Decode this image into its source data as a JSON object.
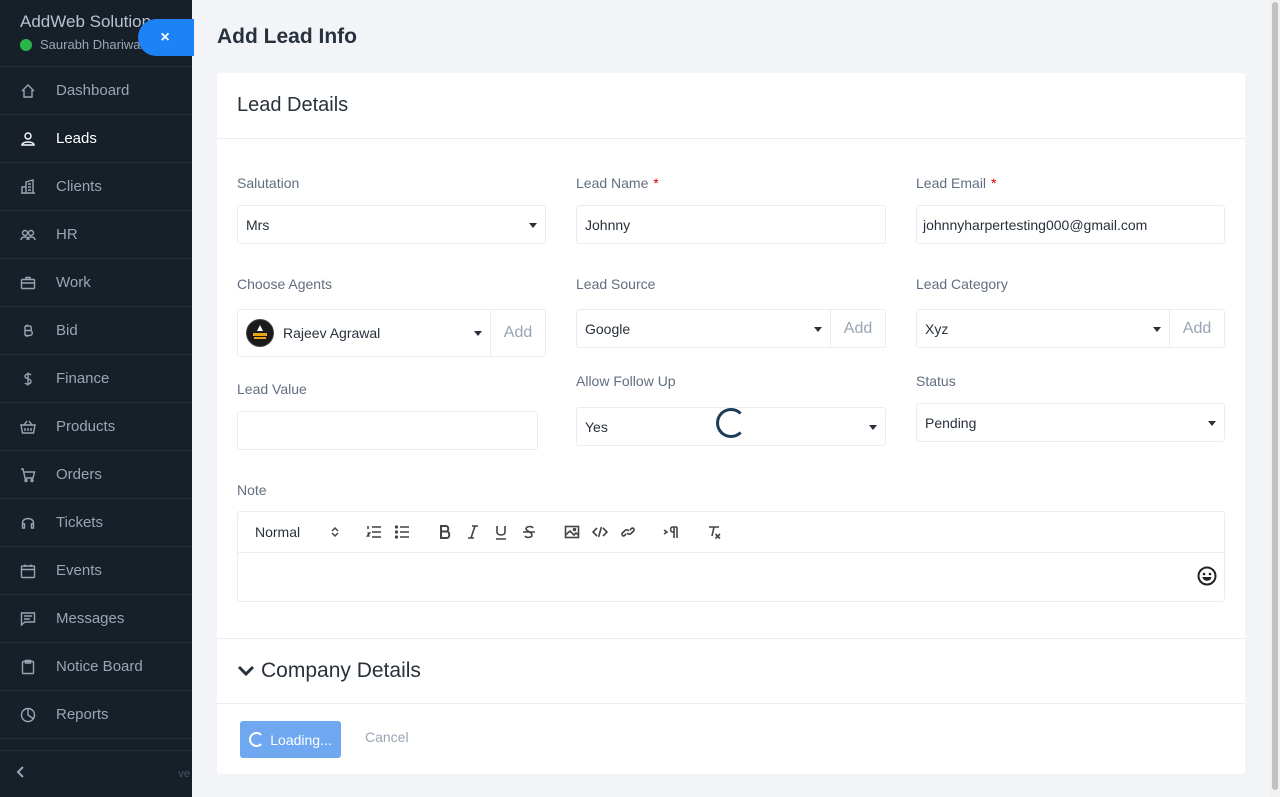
{
  "sidebar": {
    "company": "AddWeb Solution",
    "user": "Saurabh Dhariwal",
    "items": [
      {
        "label": "Dashboard",
        "icon": "home-icon"
      },
      {
        "label": "Leads",
        "icon": "user-icon"
      },
      {
        "label": "Clients",
        "icon": "building-icon"
      },
      {
        "label": "HR",
        "icon": "people-icon"
      },
      {
        "label": "Work",
        "icon": "briefcase-icon"
      },
      {
        "label": "Bid",
        "icon": "bitcoin-icon"
      },
      {
        "label": "Finance",
        "icon": "dollar-icon"
      },
      {
        "label": "Products",
        "icon": "basket-icon"
      },
      {
        "label": "Orders",
        "icon": "cart-icon"
      },
      {
        "label": "Tickets",
        "icon": "headset-icon"
      },
      {
        "label": "Events",
        "icon": "calendar-icon"
      },
      {
        "label": "Messages",
        "icon": "chat-icon"
      },
      {
        "label": "Notice Board",
        "icon": "clipboard-icon"
      },
      {
        "label": "Reports",
        "icon": "pie-chart-icon"
      }
    ],
    "active": "Leads",
    "version": "ve"
  },
  "close_label": "×",
  "page": {
    "title": "Add Lead Info",
    "card_title": "Lead Details"
  },
  "form": {
    "salutation": {
      "label": "Salutation",
      "value": "Mrs"
    },
    "lead_name": {
      "label": "Lead Name",
      "value": "Johnny",
      "required": "*"
    },
    "lead_email": {
      "label": "Lead Email",
      "value": "johnnyharpertesting000@gmail.com",
      "required": "*"
    },
    "agents": {
      "label": "Choose Agents",
      "value": "Rajeev Agrawal",
      "add": "Add"
    },
    "source": {
      "label": "Lead Source",
      "value": "Google",
      "add": "Add"
    },
    "category": {
      "label": "Lead Category",
      "value": "Xyz",
      "add": "Add"
    },
    "lead_value": {
      "label": "Lead Value",
      "value": ""
    },
    "follow_up": {
      "label": "Allow Follow Up",
      "value": "Yes"
    },
    "status": {
      "label": "Status",
      "value": "Pending"
    },
    "note": {
      "label": "Note",
      "format": "Normal"
    }
  },
  "company_section": "Company Details",
  "actions": {
    "loading": "Loading...",
    "cancel": "Cancel"
  },
  "colors": {
    "accent": "#1d82f5",
    "sidebar": "#171f29",
    "required": "#d30000"
  }
}
